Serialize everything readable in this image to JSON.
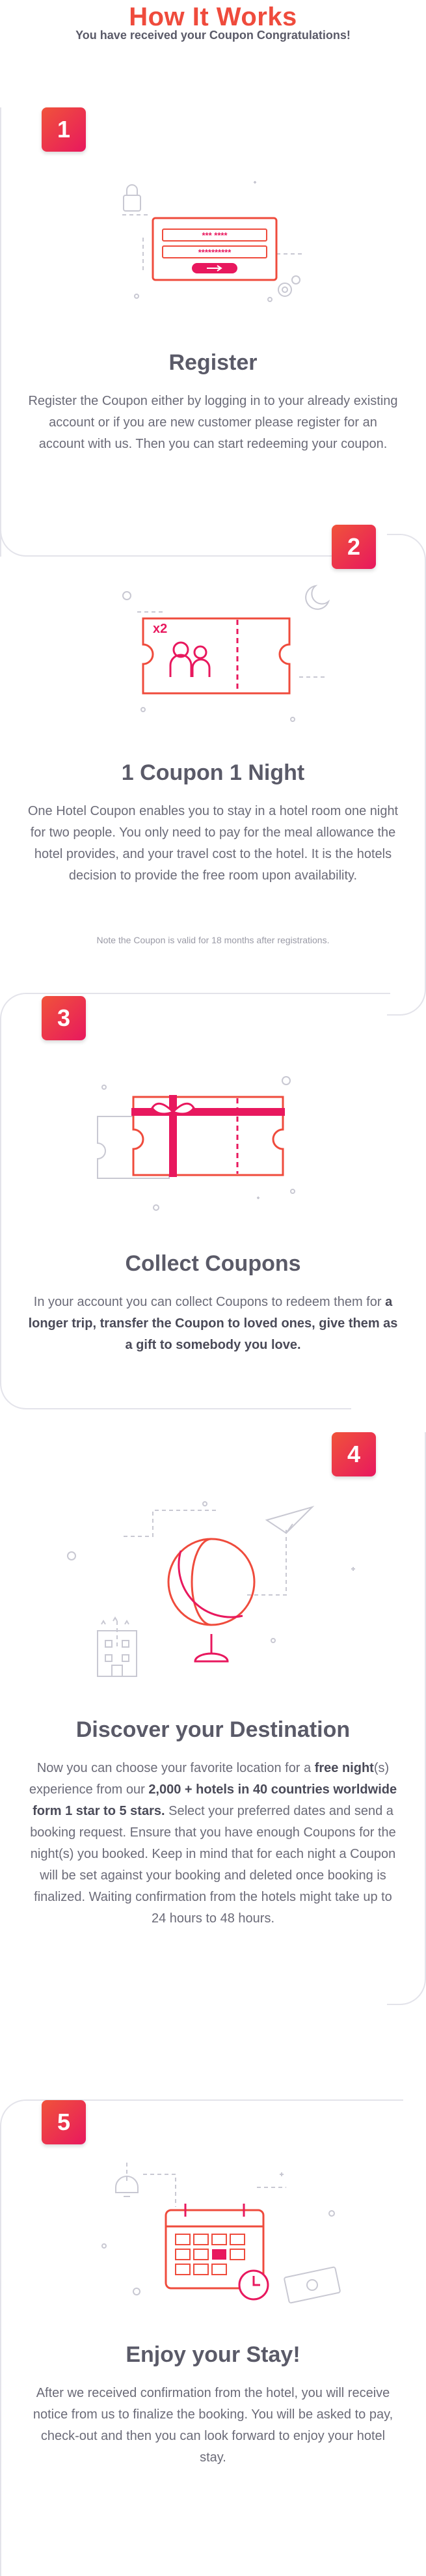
{
  "header": {
    "title": "How It Works",
    "subtitle": "You have received your Coupon Congratulations!"
  },
  "steps": [
    {
      "number": "1",
      "title": "Register",
      "text": "Register the Coupon either by logging in to your already existing account or if you are new customer please register for an account with us. Then you can start redeeming your coupon.",
      "icon": "login-form-icon",
      "form_password_1": "*** ****",
      "form_password_2": "**********"
    },
    {
      "number": "2",
      "title": "1 Coupon 1 Night",
      "text": "One Hotel Coupon enables you to stay in a hotel room one night for two people. You only need to pay for the meal allowance the hotel provides, and your travel cost to the hotel. It is the hotels decision to provide the free room upon availability.",
      "note": "Note the Coupon is valid for 18 months after registrations.",
      "icon": "coupon-ticket-icon",
      "ticket_label": "x2"
    },
    {
      "number": "3",
      "title": "Collect Coupons",
      "text_1": "In your account you can collect Coupons to redeem them for ",
      "text_bold": "a longer trip, transfer the Coupon to loved ones, give them as a gift to somebody you love.",
      "icon": "gift-coupon-icon"
    },
    {
      "number": "4",
      "title": "Discover your Destination",
      "t1": "Now you can choose your favorite location for a ",
      "b1": "free night",
      "t2": "(s) experience from our ",
      "b2": "2,000 + hotels in 40 countries worldwide form 1 star to 5 stars.",
      "t3": " Select your preferred dates and send a booking request. Ensure that you have enough Coupons for the night(s) you booked. Keep in mind that for each night a Coupon will be set against your booking and deleted once booking is finalized. Waiting confirmation from the hotels might take up to 24 hours to 48 hours.",
      "icon": "globe-icon"
    },
    {
      "number": "5",
      "title": "Enjoy your Stay!",
      "text": "After we received confirmation from the hotel, you will receive notice from us to finalize the booking. You will be asked to pay, check-out and then you can look forward to enjoy your hotel stay.",
      "icon": "calendar-icon"
    }
  ],
  "colors": {
    "accent": "#ef4b3c",
    "pink": "#e8185e",
    "text": "#6b6b78",
    "frame": "#e3e3ea"
  }
}
